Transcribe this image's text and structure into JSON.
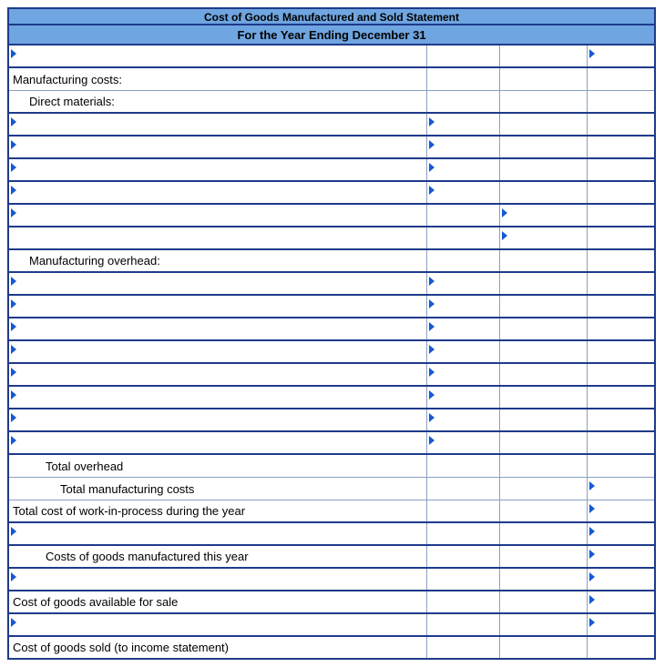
{
  "header": {
    "title_line1": "Cost of Goods Manufactured and Sold Statement",
    "title_line2": "For the Year Ending December 31"
  },
  "rows": [
    {
      "label": "",
      "indent": 0,
      "dd": [
        true,
        false,
        false,
        true
      ]
    },
    {
      "label": "Manufacturing costs:",
      "indent": 0,
      "dd": [
        false,
        false,
        false,
        false
      ],
      "thin": true
    },
    {
      "label": "Direct materials:",
      "indent": 1,
      "dd": [
        false,
        false,
        false,
        false
      ]
    },
    {
      "label": "",
      "indent": 0,
      "dd": [
        true,
        true,
        false,
        false
      ]
    },
    {
      "label": "",
      "indent": 0,
      "dd": [
        true,
        true,
        false,
        false
      ]
    },
    {
      "label": "",
      "indent": 0,
      "dd": [
        true,
        true,
        false,
        false
      ]
    },
    {
      "label": "",
      "indent": 0,
      "dd": [
        true,
        true,
        false,
        false
      ]
    },
    {
      "label": "",
      "indent": 0,
      "dd": [
        true,
        false,
        true,
        false
      ]
    },
    {
      "label": "",
      "indent": 0,
      "dd": [
        false,
        false,
        true,
        false
      ]
    },
    {
      "label": "Manufacturing overhead:",
      "indent": 1,
      "dd": [
        false,
        false,
        false,
        false
      ]
    },
    {
      "label": "",
      "indent": 0,
      "dd": [
        true,
        true,
        false,
        false
      ]
    },
    {
      "label": "",
      "indent": 0,
      "dd": [
        true,
        true,
        false,
        false
      ]
    },
    {
      "label": "",
      "indent": 0,
      "dd": [
        true,
        true,
        false,
        false
      ]
    },
    {
      "label": "",
      "indent": 0,
      "dd": [
        true,
        true,
        false,
        false
      ]
    },
    {
      "label": "",
      "indent": 0,
      "dd": [
        true,
        true,
        false,
        false
      ]
    },
    {
      "label": "",
      "indent": 0,
      "dd": [
        true,
        true,
        false,
        false
      ]
    },
    {
      "label": "",
      "indent": 0,
      "dd": [
        true,
        true,
        false,
        false
      ]
    },
    {
      "label": "",
      "indent": 0,
      "dd": [
        true,
        true,
        false,
        false
      ]
    },
    {
      "label": "Total overhead",
      "indent": 2,
      "dd": [
        false,
        false,
        false,
        false
      ],
      "thin": true
    },
    {
      "label": "Total manufacturing costs",
      "indent": 3,
      "dd": [
        false,
        false,
        false,
        true
      ],
      "thin": true
    },
    {
      "label": "Total cost of work-in-process during the year",
      "indent": 0,
      "dd": [
        false,
        false,
        false,
        true
      ]
    },
    {
      "label": "",
      "indent": 0,
      "dd": [
        true,
        false,
        false,
        true
      ]
    },
    {
      "label": "Costs of goods manufactured this year",
      "indent": 2,
      "dd": [
        false,
        false,
        false,
        true
      ]
    },
    {
      "label": "",
      "indent": 0,
      "dd": [
        true,
        false,
        false,
        true
      ]
    },
    {
      "label": "Cost of goods available for sale",
      "indent": 0,
      "dd": [
        false,
        false,
        false,
        true
      ]
    },
    {
      "label": "",
      "indent": 0,
      "dd": [
        true,
        false,
        false,
        true
      ]
    },
    {
      "label": "Cost of goods sold (to income statement)",
      "indent": 0,
      "dd": [
        false,
        false,
        false,
        false
      ]
    }
  ]
}
